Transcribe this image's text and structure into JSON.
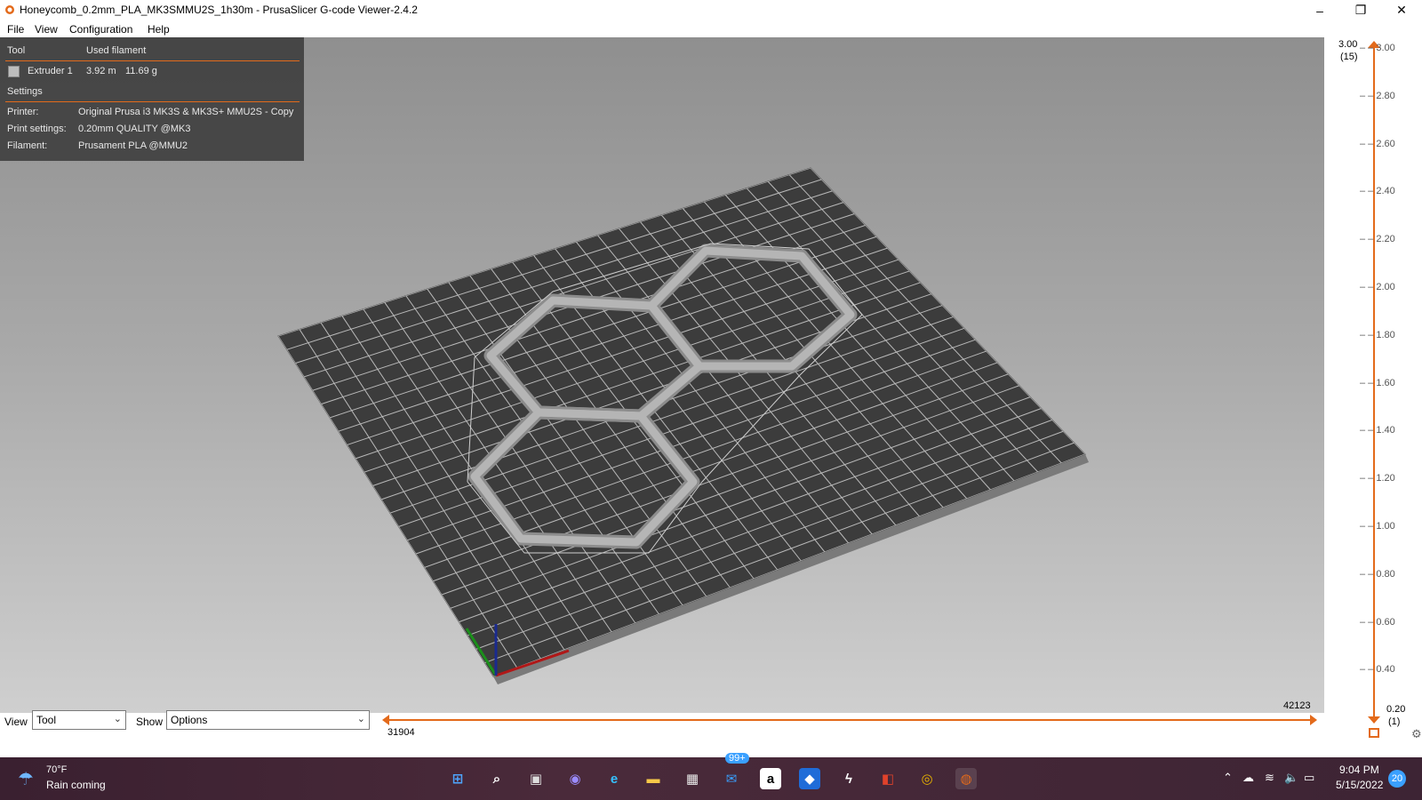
{
  "window": {
    "title": "Honeycomb_0.2mm_PLA_MK3SMMU2S_1h30m - PrusaSlicer G-code Viewer-2.4.2",
    "buttons": [
      "–",
      "❐",
      "✕"
    ]
  },
  "menu": [
    "File",
    "View",
    "Configuration",
    "Help"
  ],
  "legend": {
    "col_tool": "Tool",
    "col_used": "Used filament",
    "extruder": {
      "name": "Extruder 1",
      "length": "3.92 m",
      "weight": "11.69 g",
      "color": "#bdbdbd"
    },
    "settings_header": "Settings",
    "printer_label": "Printer:",
    "printer_value": "Original Prusa i3 MK3S & MK3S+ MMU2S - Copy",
    "print_label": "Print settings:",
    "print_value": "0.20mm QUALITY @MK3",
    "filament_label": "Filament:",
    "filament_value": "Prusament PLA @MMU2"
  },
  "layer_slider": {
    "top_value": "3.00",
    "top_layer": "(15)",
    "bottom_value": "0.20",
    "bottom_layer": "(1)",
    "ticks": [
      "3.00",
      "2.80",
      "2.60",
      "2.40",
      "2.20",
      "2.00",
      "1.80",
      "1.60",
      "1.40",
      "1.20",
      "1.00",
      "0.80",
      "0.60",
      "0.40"
    ],
    "accent": "#e36a1b"
  },
  "move_slider": {
    "right_value": "42123",
    "left_value": "31904"
  },
  "bottom": {
    "view_label": "View",
    "view_value": "Tool",
    "show_label": "Show",
    "show_value": "Options"
  },
  "taskbar": {
    "weather_temp": "70°F",
    "weather_desc": "Rain coming",
    "mail_badge": "99+",
    "time": "9:04 PM",
    "date": "5/15/2022",
    "notif_count": "20"
  }
}
